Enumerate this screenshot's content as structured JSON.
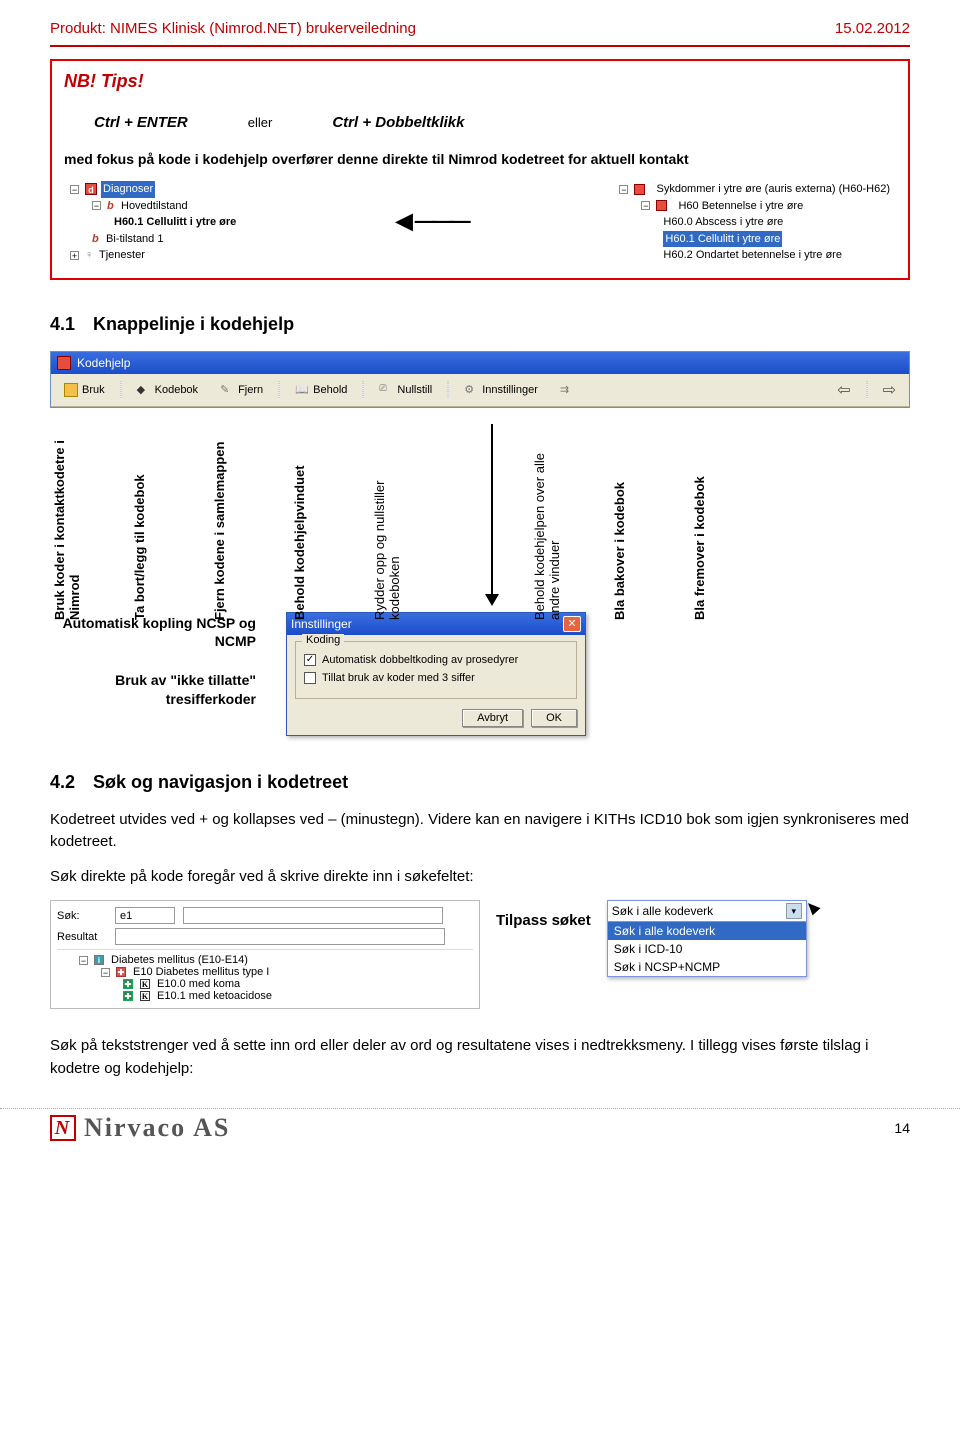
{
  "header": {
    "product": "Produkt: NIMES Klinisk (Nimrod.NET) brukerveiledning",
    "date": "15.02.2012"
  },
  "tip_box": {
    "nb": "NB! Tips!",
    "ctrl_enter": "Ctrl + ENTER",
    "eller": "eller",
    "ctrl_dbl": "Ctrl + Dobbeltklikk",
    "desc": "med fokus på kode i kodehjelp overfører denne direkte til Nimrod kodetreet for aktuell kontakt",
    "left_tree": {
      "diagnoser": "Diagnoser",
      "hoved": "Hovedtilstand",
      "h601": "H60.1 Cellulitt i ytre øre",
      "bi1": "Bi-tilstand 1",
      "tjen": "Tjenester"
    },
    "right_tree": {
      "group": "Sykdommer i ytre øre (auris externa) (H60-H62)",
      "h60": "H60 Betennelse i ytre øre",
      "h600": "H60.0 Abscess i ytre øre",
      "h601": "H60.1 Cellulitt i ytre øre",
      "h602": "H60.2 Ondartet betennelse i ytre øre"
    }
  },
  "section41": {
    "num": "4.1",
    "title": "Knappelinje i kodehjelp"
  },
  "toolbar": {
    "window_title": "Kodehjelp",
    "bruk": "Bruk",
    "kodebok": "Kodebok",
    "fjern": "Fjern",
    "behold": "Behold",
    "nullstill": "Nullstill",
    "innst": "Innstillinger",
    "vlabels": [
      "Bruk koder i kontaktkodetre i Nimrod",
      "Ta bort/legg til kodebok",
      "Fjern kodene i samlemappen",
      "Behold kodehjelpvinduet",
      "Rydder opp og nullstiller kodeboken",
      "Behold kodehjelpen over alle andre vinduer",
      "Bla bakover i kodebok",
      "Bla fremover i kodebok"
    ],
    "side_labels": {
      "a": "Automatisk kopling NCSP og NCMP",
      "b": "Bruk av \"ikke tillatte\" tresifferkoder"
    }
  },
  "dialog": {
    "title": "Innstillinger",
    "group": "Koding",
    "chk1": "Automatisk dobbeltkoding av prosedyrer",
    "chk1_checked": true,
    "chk2": "Tillat bruk av koder med 3 siffer",
    "chk2_checked": false,
    "avbryt": "Avbryt",
    "ok": "OK"
  },
  "section42": {
    "num": "4.2",
    "title": "Søk og navigasjon i kodetreet",
    "p1": "Kodetreet utvides ved + og kollapses ved – (minustegn). Videre kan en navigere i KITHs ICD10 bok som igjen synkroniseres med kodetreet.",
    "p2": "Søk direkte på kode foregår ved å skrive direkte inn i søkefeltet:",
    "p3": "Søk på tekststrenger ved å sette inn ord eller deler av ord og resultatene vises i nedtrekksmeny. I tillegg vises første tilslag i kodetre og kodehjelp:"
  },
  "search_shot": {
    "sok_label": "Søk:",
    "sok_val": "e1",
    "resultat_label": "Resultat",
    "resultat_val": "",
    "tree_group": "Diabetes mellitus (E10-E14)",
    "tree_e10": "E10 Diabetes mellitus type I",
    "tree_e100": "E10.0 med koma",
    "tree_e101": "E10.1 med ketoacidose",
    "tilpass": "Tilpass søket",
    "dd_top": "Søk i alle kodeverk",
    "dd_items": [
      "Søk i alle kodeverk",
      "Søk i ICD-10",
      "Søk i NCSP+NCMP"
    ],
    "dd_selected_index": 0
  },
  "footer": {
    "brand": "Nirvaco AS",
    "page": "14"
  }
}
